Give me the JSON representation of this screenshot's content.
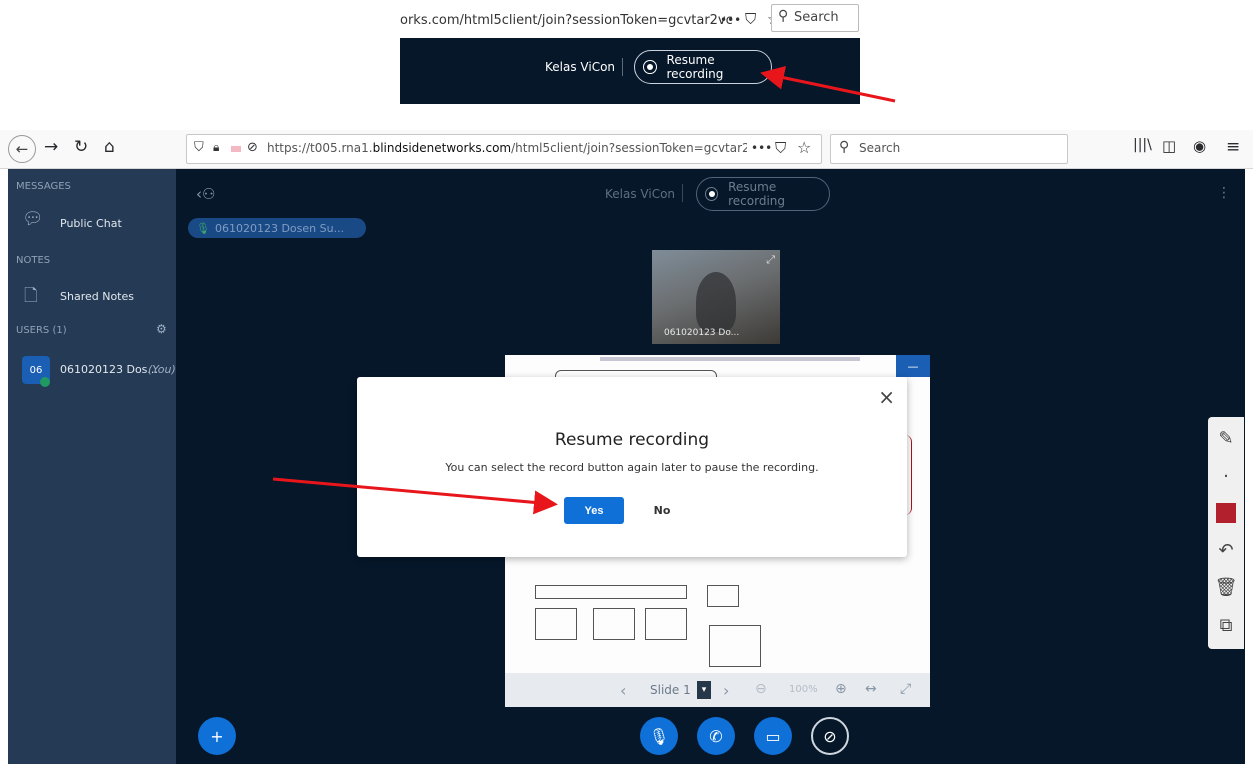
{
  "inset": {
    "url": "orks.com/html5client/join?sessionToken=gcvtar2vc",
    "search": "Search",
    "meeting_name": "Kelas ViCon",
    "record_label": "Resume recording"
  },
  "browser": {
    "url_prefix": "https://t005.rna1.",
    "url_domain": "blindsidenetworks.com",
    "url_rest": "/html5client/join?sessionToken=gcvtar2vc",
    "search_placeholder": "Search",
    "menu_dots": "•••"
  },
  "sidebar": {
    "messages_head": "MESSAGES",
    "public_chat": "Public Chat",
    "notes_head": "NOTES",
    "shared_notes": "Shared Notes",
    "users_head": "USERS (1)",
    "user_avatar": "06",
    "user_name": "061020123 Dos...",
    "user_you": "(You)"
  },
  "main": {
    "meeting_name": "Kelas ViCon",
    "record_label": "Resume recording",
    "talker": "061020123 Dosen Su...",
    "video_label": "061020123 Do...",
    "slide_label": "Slide 1",
    "zoom": "100%"
  },
  "modal": {
    "title": "Resume recording",
    "description": "You can select the record button again later to pause the recording.",
    "yes": "Yes",
    "no": "No",
    "close": "×"
  },
  "colors": {
    "annotation_arrow": "#e8151b",
    "accent": "#0f70d7",
    "navbar": "#06172a",
    "sidebar": "#243a55"
  }
}
